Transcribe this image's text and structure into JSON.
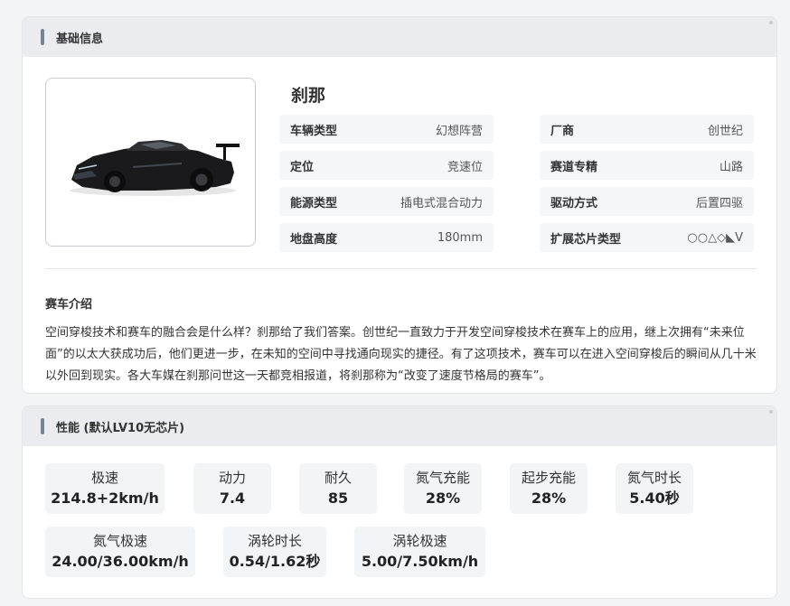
{
  "basic": {
    "header": "基础信息",
    "car_name": "刹那",
    "attributes": [
      {
        "key": "车辆类型",
        "value": "幻想阵营"
      },
      {
        "key": "厂商",
        "value": "创世纪"
      },
      {
        "key": "定位",
        "value": "竞速位"
      },
      {
        "key": "赛道专精",
        "value": "山路"
      },
      {
        "key": "能源类型",
        "value": "插电式混合动力"
      },
      {
        "key": "驱动方式",
        "value": "后置四驱"
      },
      {
        "key": "地盘高度",
        "value": "180mm"
      },
      {
        "key": "扩展芯片类型",
        "value": "○○△◇◣V"
      }
    ],
    "intro_title": "赛车介绍",
    "intro_text": "空间穿梭技术和赛车的融合会是什么样？刹那给了我们答案。创世纪一直致力于开发空间穿梭技术在赛车上的应用，继上次拥有“未来位面”的以太大获成功后，他们更进一步，在未知的空间中寻找通向现实的捷径。有了这项技术，赛车可以在进入空间穿梭后的瞬间从几十米以外回到现实。各大车媒在刹那问世这一天都竞相报道，将刹那称为“改变了速度节格局的赛车”。"
  },
  "performance": {
    "header": "性能 (默认LV10无芯片)",
    "stats": [
      {
        "label": "极速",
        "value": "214.8+2km/h"
      },
      {
        "label": "动力",
        "value": "7.4"
      },
      {
        "label": "耐久",
        "value": "85"
      },
      {
        "label": "氮气充能",
        "value": "28%"
      },
      {
        "label": "起步充能",
        "value": "28%"
      },
      {
        "label": "氮气时长",
        "value": "5.40秒"
      },
      {
        "label": "氮气极速",
        "value": "24.00/36.00km/h"
      },
      {
        "label": "涡轮时长",
        "value": "0.54/1.62秒"
      },
      {
        "label": "涡轮极速",
        "value": "5.00/7.50km/h"
      }
    ]
  }
}
